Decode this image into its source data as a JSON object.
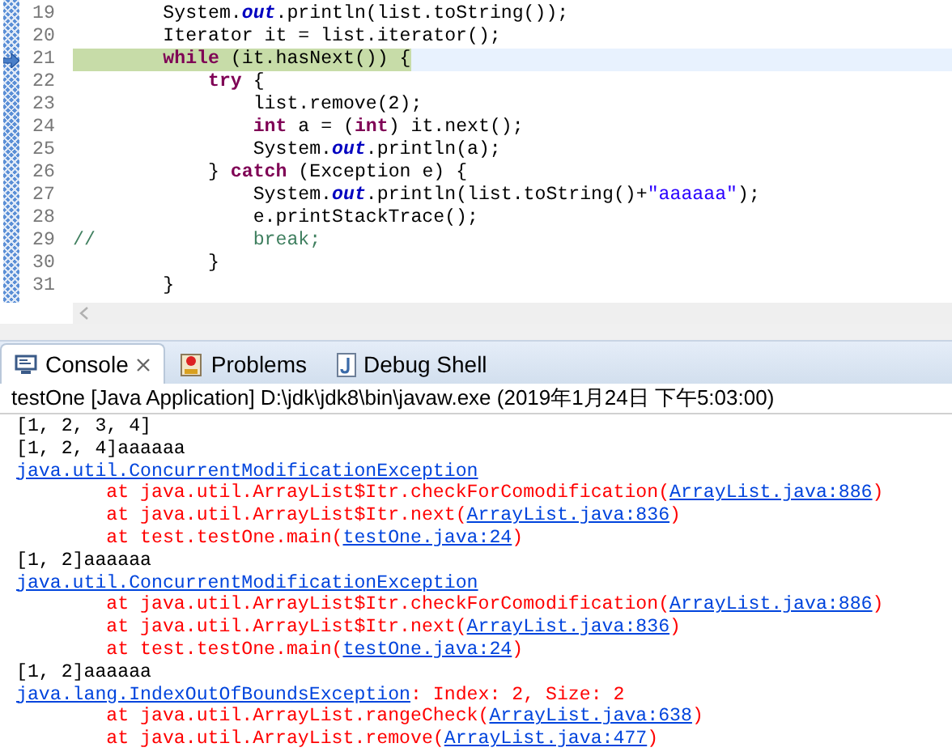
{
  "editor": {
    "lines": [
      {
        "number": "19",
        "current": false,
        "segments": [
          {
            "kind": "plain",
            "text": "        System."
          },
          {
            "kind": "field",
            "text": "out"
          },
          {
            "kind": "plain",
            "text": ".println(list.toString());"
          }
        ]
      },
      {
        "number": "20",
        "current": false,
        "segments": [
          {
            "kind": "plain",
            "text": "        Iterator it = list.iterator();"
          }
        ]
      },
      {
        "number": "21",
        "current": true,
        "segments": [
          {
            "kind": "keyword",
            "text": "        while"
          },
          {
            "kind": "plain",
            "text": " (it.hasNext()) {"
          }
        ]
      },
      {
        "number": "22",
        "current": false,
        "segments": [
          {
            "kind": "keyword",
            "text": "            try"
          },
          {
            "kind": "plain",
            "text": " {"
          }
        ]
      },
      {
        "number": "23",
        "current": false,
        "segments": [
          {
            "kind": "plain",
            "text": "                list.remove(2);"
          }
        ]
      },
      {
        "number": "24",
        "current": false,
        "segments": [
          {
            "kind": "keyword",
            "text": "                int"
          },
          {
            "kind": "plain",
            "text": " a = ("
          },
          {
            "kind": "keyword",
            "text": "int"
          },
          {
            "kind": "plain",
            "text": ") it.next();"
          }
        ]
      },
      {
        "number": "25",
        "current": false,
        "segments": [
          {
            "kind": "plain",
            "text": "                System."
          },
          {
            "kind": "field",
            "text": "out"
          },
          {
            "kind": "plain",
            "text": ".println(a);"
          }
        ]
      },
      {
        "number": "26",
        "current": false,
        "segments": [
          {
            "kind": "plain",
            "text": "            } "
          },
          {
            "kind": "keyword",
            "text": "catch"
          },
          {
            "kind": "plain",
            "text": " (Exception e) {"
          }
        ]
      },
      {
        "number": "27",
        "current": false,
        "segments": [
          {
            "kind": "plain",
            "text": "                System."
          },
          {
            "kind": "field",
            "text": "out"
          },
          {
            "kind": "plain",
            "text": ".println(list.toString()+"
          },
          {
            "kind": "string",
            "text": "\"aaaaaa\""
          },
          {
            "kind": "plain",
            "text": ");"
          }
        ]
      },
      {
        "number": "28",
        "current": false,
        "segments": [
          {
            "kind": "plain",
            "text": "                e.printStackTrace();"
          }
        ]
      },
      {
        "number": "29",
        "current": false,
        "segments": [
          {
            "kind": "comment",
            "text": "//              break;"
          }
        ]
      },
      {
        "number": "30",
        "current": false,
        "segments": [
          {
            "kind": "plain",
            "text": "            }"
          }
        ]
      },
      {
        "number": "31",
        "current": false,
        "segments": [
          {
            "kind": "plain",
            "text": "        }"
          }
        ]
      }
    ]
  },
  "tabs": [
    {
      "label": "Console",
      "selected": true,
      "closable": true
    },
    {
      "label": "Problems",
      "selected": false,
      "closable": false
    },
    {
      "label": "Debug Shell",
      "selected": false,
      "closable": false
    }
  ],
  "console": {
    "header": "testOne [Java Application] D:\\jdk\\jdk8\\bin\\javaw.exe (2019年1月24日 下午5:03:00)",
    "lines": [
      [
        {
          "kind": "plain",
          "text": "[1, 2, 3, 4]"
        }
      ],
      [
        {
          "kind": "plain",
          "text": "[1, 2, 4]aaaaaa"
        }
      ],
      [
        {
          "kind": "link",
          "text": "java.util.ConcurrentModificationException"
        }
      ],
      [
        {
          "kind": "error",
          "text": "        at java.util.ArrayList$Itr.checkForComodification("
        },
        {
          "kind": "link",
          "text": "ArrayList.java:886"
        },
        {
          "kind": "error",
          "text": ")"
        }
      ],
      [
        {
          "kind": "error",
          "text": "        at java.util.ArrayList$Itr.next("
        },
        {
          "kind": "link",
          "text": "ArrayList.java:836"
        },
        {
          "kind": "error",
          "text": ")"
        }
      ],
      [
        {
          "kind": "error",
          "text": "        at test.testOne.main("
        },
        {
          "kind": "link",
          "text": "testOne.java:24"
        },
        {
          "kind": "error",
          "text": ")"
        }
      ],
      [
        {
          "kind": "plain",
          "text": "[1, 2]aaaaaa"
        }
      ],
      [
        {
          "kind": "link",
          "text": "java.util.ConcurrentModificationException"
        }
      ],
      [
        {
          "kind": "error",
          "text": "        at java.util.ArrayList$Itr.checkForComodification("
        },
        {
          "kind": "link",
          "text": "ArrayList.java:886"
        },
        {
          "kind": "error",
          "text": ")"
        }
      ],
      [
        {
          "kind": "error",
          "text": "        at java.util.ArrayList$Itr.next("
        },
        {
          "kind": "link",
          "text": "ArrayList.java:836"
        },
        {
          "kind": "error",
          "text": ")"
        }
      ],
      [
        {
          "kind": "error",
          "text": "        at test.testOne.main("
        },
        {
          "kind": "link",
          "text": "testOne.java:24"
        },
        {
          "kind": "error",
          "text": ")"
        }
      ],
      [
        {
          "kind": "plain",
          "text": "[1, 2]aaaaaa"
        }
      ],
      [
        {
          "kind": "link",
          "text": "java.lang.IndexOutOfBoundsException"
        },
        {
          "kind": "error",
          "text": ": Index: 2, Size: 2"
        }
      ],
      [
        {
          "kind": "error",
          "text": "        at java.util.ArrayList.rangeCheck("
        },
        {
          "kind": "link",
          "text": "ArrayList.java:638"
        },
        {
          "kind": "error",
          "text": ")"
        }
      ],
      [
        {
          "kind": "error",
          "text": "        at java.util.ArrayList.remove("
        },
        {
          "kind": "link",
          "text": "ArrayList.java:477"
        },
        {
          "kind": "error",
          "text": ")"
        }
      ]
    ]
  }
}
